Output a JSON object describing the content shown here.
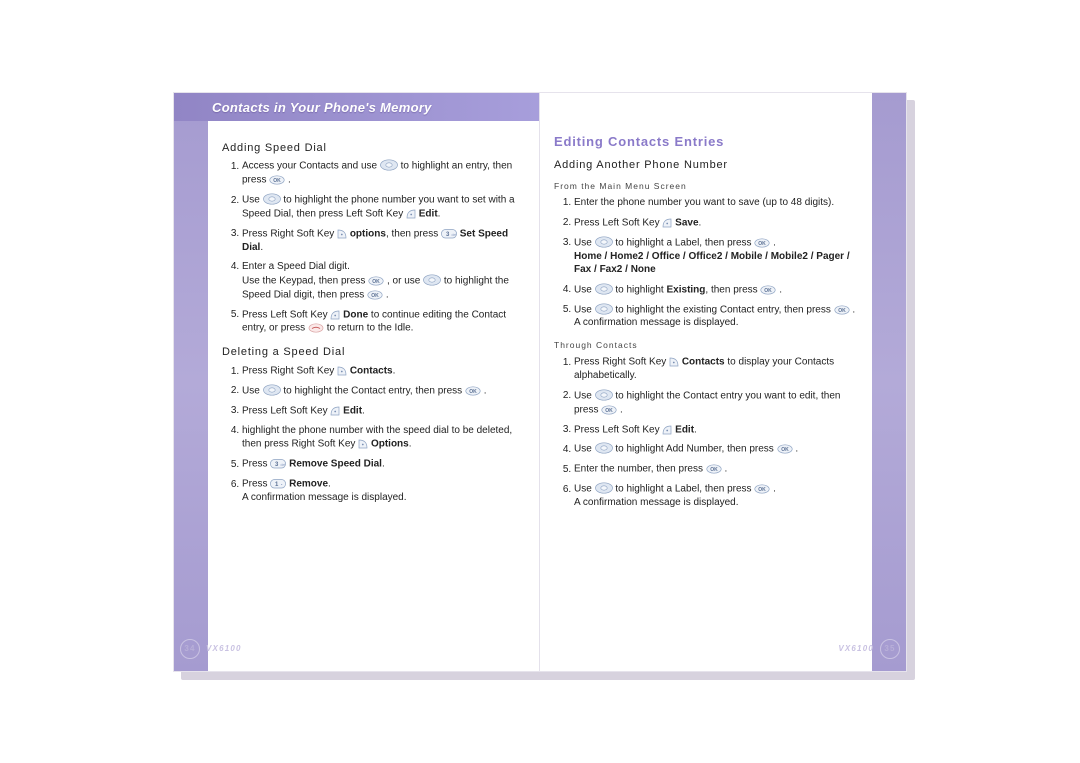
{
  "header": {
    "title": "Contacts in Your Phone's Memory"
  },
  "model": "VX6100",
  "left_page_num": "34",
  "right_page_num": "35",
  "left": {
    "s1_title": "Adding Speed Dial",
    "s1_i1_a": "Access your Contacts and use ",
    "s1_i1_b": " to highlight an entry, then press ",
    "s1_i1_c": " .",
    "s1_i2_a": "Use ",
    "s1_i2_b": " to highlight the phone number you want to set with a Speed Dial, then press  Left Soft Key ",
    "s1_i2_c": " ",
    "s1_i2_bold": "Edit",
    "s1_i2_d": ".",
    "s1_i3_a": "Press Right Soft Key ",
    "s1_i3_b": " ",
    "s1_i3_bold1": "options",
    "s1_i3_c": ", then press ",
    "s1_i3_d": " ",
    "s1_i3_bold2": "Set Speed Dial",
    "s1_i3_e": ".",
    "s1_i4_a": "Enter a Speed Dial digit.",
    "s1_i4_b": "Use the Keypad, then press ",
    "s1_i4_c": " , or use ",
    "s1_i4_d": " to highlight the Speed Dial digit, then press ",
    "s1_i4_e": " .",
    "s1_i5_a": "Press Left Soft Key ",
    "s1_i5_b": " ",
    "s1_i5_bold": "Done",
    "s1_i5_c": " to continue editing the Contact entry, or press ",
    "s1_i5_d": " to return to the Idle.",
    "s2_title": "Deleting a Speed Dial",
    "s2_i1_a": "Press Right Soft Key ",
    "s2_i1_b": " ",
    "s2_i1_bold": "Contacts",
    "s2_i1_c": ".",
    "s2_i2_a": "Use ",
    "s2_i2_b": " to highlight the Contact entry, then press ",
    "s2_i2_c": " .",
    "s2_i3_a": "Press Left Soft Key ",
    "s2_i3_b": " ",
    "s2_i3_bold": "Edit",
    "s2_i3_c": ".",
    "s2_i4_a": "highlight the phone number with the speed dial to be deleted, then press Right Soft Key ",
    "s2_i4_b": " ",
    "s2_i4_bold": "Options",
    "s2_i4_c": ".",
    "s2_i5_a": "Press ",
    "s2_i5_b": " ",
    "s2_i5_bold": "Remove Speed Dial",
    "s2_i5_c": ".",
    "s2_i6_a": "Press ",
    "s2_i6_b": " ",
    "s2_i6_bold": "Remove",
    "s2_i6_c": ".",
    "s2_i6_confirm": "A confirmation message is displayed."
  },
  "right": {
    "main_title": "Editing Contacts Entries",
    "s1_title": "Adding Another Phone Number",
    "sub1": "From the Main Menu Screen",
    "r1_i1": "Enter the phone number you want to save (up to 48 digits).",
    "r1_i2_a": "Press Left Soft Key ",
    "r1_i2_b": " ",
    "r1_i2_bold": "Save",
    "r1_i2_c": ".",
    "r1_i3_a": "Use ",
    "r1_i3_b": " to highlight a Label, then press ",
    "r1_i3_c": " .",
    "r1_i3_bold": "Home / Home2 / Office / Office2 / Mobile / Mobile2 / Pager / Fax / Fax2 / None",
    "r1_i4_a": "Use ",
    "r1_i4_b": " to highlight ",
    "r1_i4_bold": "Existing",
    "r1_i4_c": ", then press ",
    "r1_i4_d": " .",
    "r1_i5_a": "Use ",
    "r1_i5_b": " to highlight the existing Contact entry, then press ",
    "r1_i5_c": " .",
    "r1_i5_confirm": "A confirmation message is displayed.",
    "sub2": "Through Contacts",
    "r2_i1_a": "Press Right Soft Key ",
    "r2_i1_b": " ",
    "r2_i1_bold": "Contacts",
    "r2_i1_c": " to display your Contacts alphabetically.",
    "r2_i2_a": "Use ",
    "r2_i2_b": " to highlight the Contact entry you want to edit, then press ",
    "r2_i2_c": " .",
    "r2_i3_a": "Press Left Soft Key ",
    "r2_i3_b": " ",
    "r2_i3_bold": "Edit",
    "r2_i3_c": ".",
    "r2_i4_a": "Use ",
    "r2_i4_b": " to highlight Add Number, then press ",
    "r2_i4_c": " .",
    "r2_i5_a": "Enter the number, then press ",
    "r2_i5_b": " .",
    "r2_i6_a": "Use ",
    "r2_i6_b": " to highlight a Label, then press ",
    "r2_i6_c": " .",
    "r2_i6_confirm": "A confirmation message is displayed."
  }
}
